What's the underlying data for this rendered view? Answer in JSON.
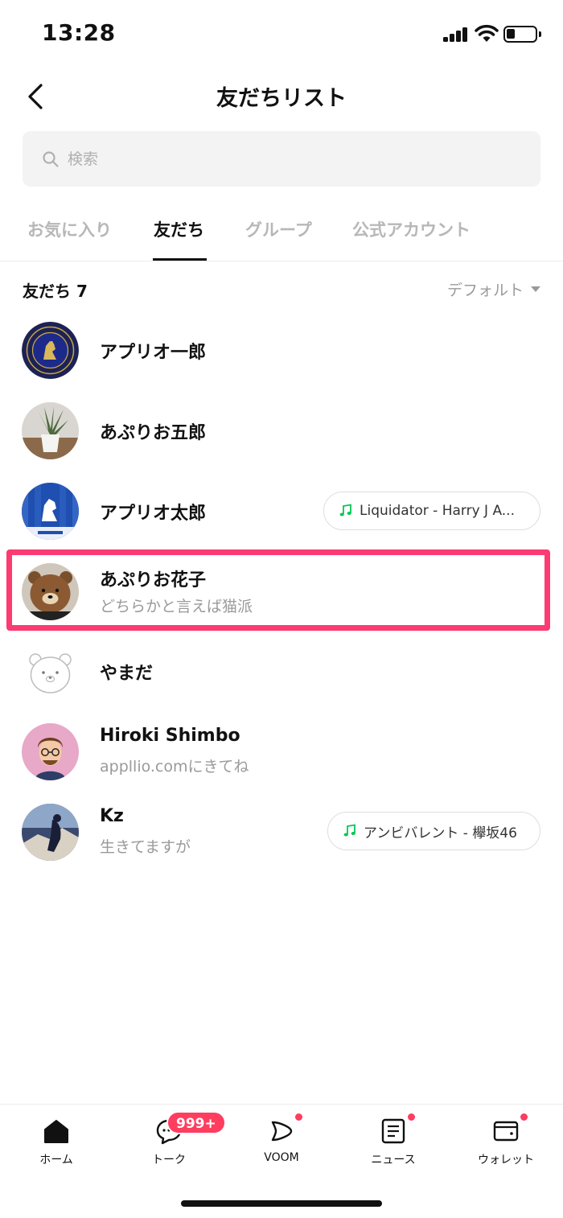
{
  "status_bar": {
    "time": "13:28"
  },
  "header": {
    "title": "友だちリスト"
  },
  "search": {
    "placeholder": "検索"
  },
  "tabs": [
    {
      "label": "お気に入り",
      "active": false
    },
    {
      "label": "友だち",
      "active": true
    },
    {
      "label": "グループ",
      "active": false
    },
    {
      "label": "公式アカウント",
      "active": false
    }
  ],
  "friends_section": {
    "title": "友だち 7",
    "sort_label": "デフォルト"
  },
  "friends": [
    {
      "name": "アプリオ一郎",
      "status": "",
      "music": "",
      "avatar": "chelsea-crest-icon"
    },
    {
      "name": "あぷりお五郎",
      "status": "",
      "music": "",
      "avatar": "plant-photo"
    },
    {
      "name": "アプリオ太郎",
      "status": "",
      "music": "Liquidator - Harry J A...",
      "avatar": "chelsea-blue-icon"
    },
    {
      "name": "あぷりお花子",
      "status": "どちらかと言えば猫派",
      "music": "",
      "avatar": "brown-bear-photo",
      "highlighted": true
    },
    {
      "name": "やまだ",
      "status": "",
      "music": "",
      "avatar": "default-bear-icon"
    },
    {
      "name": "Hiroki Shimbo",
      "status": "appllio.comにきてね",
      "music": "",
      "avatar": "cartoon-man-icon"
    },
    {
      "name": "Kz",
      "status": "生きてますが",
      "music": "アンビバレント - 欅坂46",
      "avatar": "night-photo"
    }
  ],
  "bottom_nav": {
    "items": [
      {
        "label": "ホーム",
        "icon": "home-icon",
        "dot": false
      },
      {
        "label": "トーク",
        "icon": "chat-icon",
        "dot": false
      },
      {
        "label": "VOOM",
        "icon": "voom-icon",
        "dot": true
      },
      {
        "label": "ニュース",
        "icon": "news-icon",
        "dot": true
      },
      {
        "label": "ウォレット",
        "icon": "wallet-icon",
        "dot": true
      }
    ],
    "talk_badge": "999+"
  },
  "colors": {
    "accent_highlight": "#fb3b72",
    "badge_red": "#ff3d5f",
    "music_green": "#06c755",
    "inactive_text": "#b7b7b7"
  }
}
